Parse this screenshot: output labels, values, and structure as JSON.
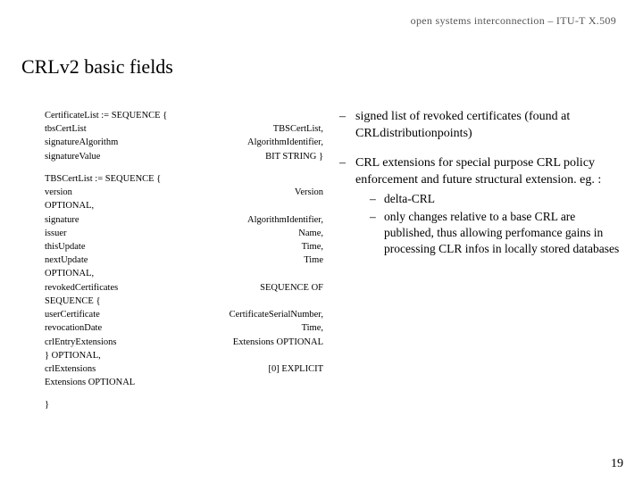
{
  "header": "open systems interconnection – ITU-T X.509",
  "title": "CRLv2 basic fields",
  "asn": {
    "block1": {
      "l1": "CertificateList  :=  SEQUENCE {",
      "r1_l": "tbsCertList",
      "r1_r": "TBSCertList,",
      "r2_l": "signatureAlgorithm",
      "r2_r": "AlgorithmIdentifier,",
      "r3_l": "signatureValue",
      "r3_r": "BIT STRING  }"
    },
    "block2": {
      "l1": "TBSCertList  :=  SEQUENCE {",
      "r1_l": "version",
      "r1_r": "Version",
      "opt1": "OPTIONAL,",
      "r2_l": "signature",
      "r2_r": "AlgorithmIdentifier,",
      "r3_l": "issuer",
      "r3_r": "Name,",
      "r4_l": "thisUpdate",
      "r4_r": "Time,",
      "r5_l": "nextUpdate",
      "r5_r": "Time",
      "opt2": "OPTIONAL,",
      "r6_l": "revokedCertificates",
      "r6_r": "SEQUENCE OF",
      "seq": "SEQUENCE {",
      "r7_l": "userCertificate",
      "r7_r": "CertificateSerialNumber,",
      "r8_l": "revocationDate",
      "r8_r": "Time,",
      "r9_l": "crlEntryExtensions",
      "r9_r": "Extensions OPTIONAL",
      "close1": "}  OPTIONAL,",
      "r10_l": "crlExtensions",
      "r10_r": "[0]  EXPLICIT",
      "ext": "Extensions OPTIONAL",
      "close2": "}"
    }
  },
  "bullets": {
    "b1": "signed list of revoked certificates (found at CRLdistributionpoints)",
    "b2": "CRL extensions for special purpose CRL policy enforcement and future structural extension. eg. :",
    "s1": "delta-CRL",
    "s2": "only changes relative to a base CRL are published, thus allowing perfomance gains in processing CLR infos in locally stored databases"
  },
  "dash": "–",
  "page": "19"
}
